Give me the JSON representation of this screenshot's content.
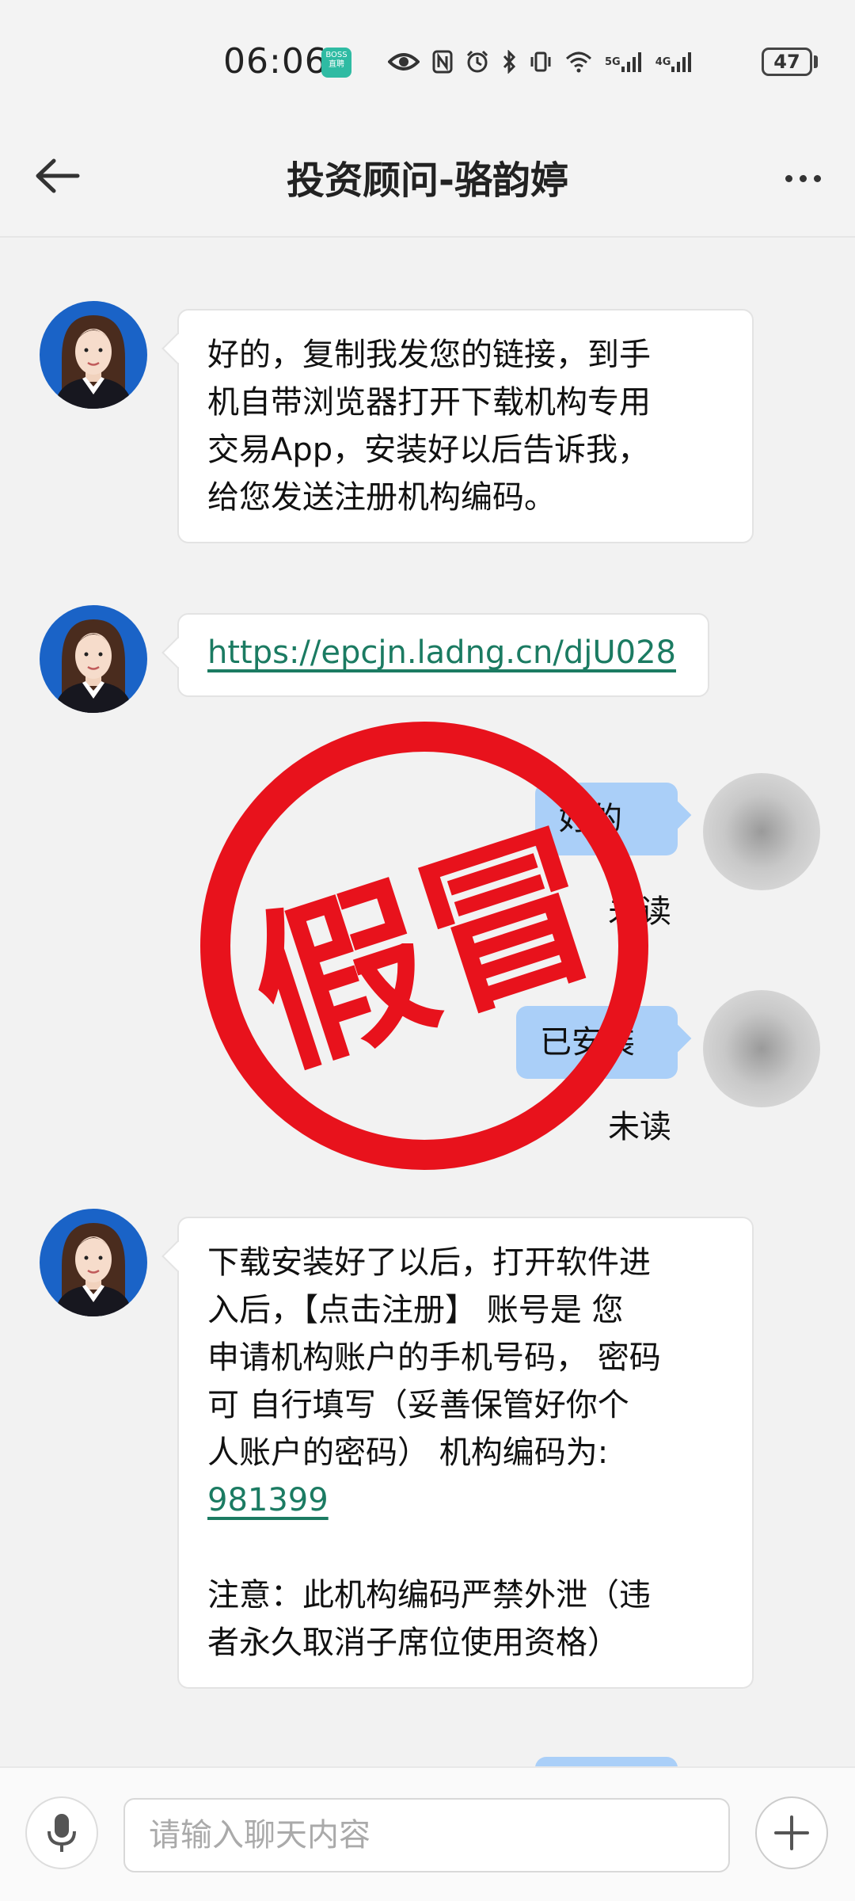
{
  "status_bar": {
    "time": "06:06",
    "app_badge": [
      "BOSS",
      "直聘"
    ],
    "net1": "5G",
    "net2": "4G",
    "battery": "47"
  },
  "header": {
    "title": "投资顾问-骆韵婷"
  },
  "messages": {
    "m1": {
      "lines": [
        "好的，复制我发您的链接，到手",
        "机自带浏览器打开下载机构专用",
        "交易App，安装好以后告诉我，",
        "给您发送注册机构编码。"
      ]
    },
    "m2": {
      "link": "https://epcjn.ladng.cn/djU028"
    },
    "r1": {
      "text": "好的",
      "status": "未读"
    },
    "r2": {
      "text": "已安装",
      "status": "未读"
    },
    "m3": {
      "lines": [
        "下载安装好了以后，打开软件进",
        "入后，【点击注册】 账号是 您",
        "申请机构账户的手机号码， 密码",
        "可 自行填写（妥善保管好你个",
        "人账户的密码） 机构编码为:"
      ],
      "code": "981399",
      "note_lines": [
        "注意：此机构编码严禁外泄（违",
        "者永久取消子席位使用资格）"
      ]
    }
  },
  "stamp": {
    "text": "假冒",
    "color": "#e8121c"
  },
  "input": {
    "placeholder": "请输入聊天内容"
  }
}
